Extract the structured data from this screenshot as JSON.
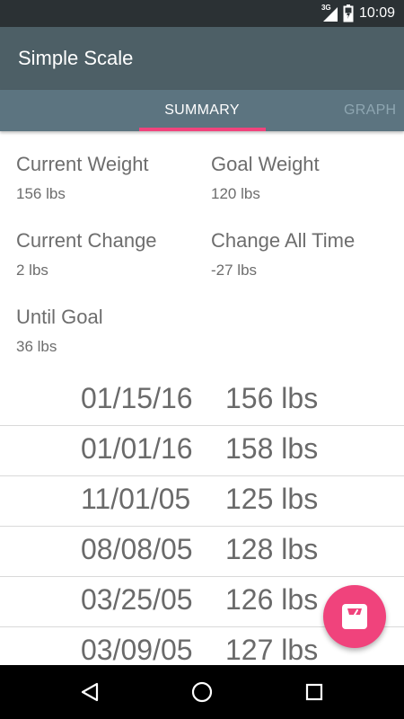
{
  "status_bar": {
    "network": "3G",
    "time": "10:09",
    "icons": [
      "signal-icon",
      "battery-icon"
    ]
  },
  "app_bar": {
    "title": "Simple Scale"
  },
  "tabs": [
    {
      "label": "SUMMARY",
      "selected": true
    },
    {
      "label": "GRAPH",
      "selected": false
    }
  ],
  "summary": {
    "current_weight": {
      "label": "Current Weight",
      "value": "156 lbs"
    },
    "goal_weight": {
      "label": "Goal Weight",
      "value": "120 lbs"
    },
    "current_change": {
      "label": "Current Change",
      "value": "2 lbs"
    },
    "change_all_time": {
      "label": "Change All Time",
      "value": "-27 lbs"
    },
    "until_goal": {
      "label": "Until Goal",
      "value": "36 lbs"
    }
  },
  "history": [
    {
      "date": "01/15/16",
      "weight": "156 lbs"
    },
    {
      "date": "01/01/16",
      "weight": "158 lbs"
    },
    {
      "date": "11/01/05",
      "weight": "125 lbs"
    },
    {
      "date": "08/08/05",
      "weight": "128 lbs"
    },
    {
      "date": "03/25/05",
      "weight": "126 lbs"
    },
    {
      "date": "03/09/05",
      "weight": "127 lbs"
    }
  ],
  "fab": {
    "icon": "scale-icon"
  },
  "nav_bar": {
    "icons": [
      "back-icon",
      "home-icon",
      "recents-icon"
    ]
  },
  "colors": {
    "status_bar": "#2b3134",
    "app_bar": "#4d5f66",
    "tab_bar": "#5c7480",
    "accent": "#f0437c",
    "text": "#6d6d6d"
  }
}
